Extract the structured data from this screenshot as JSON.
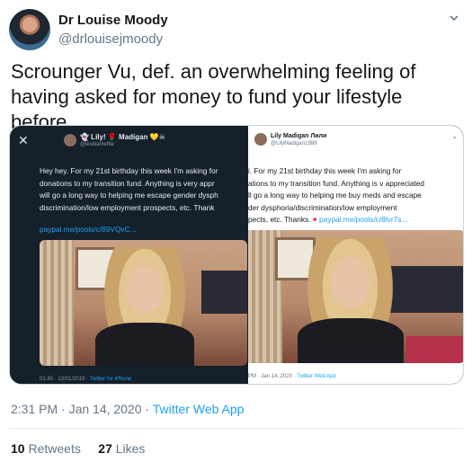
{
  "author": {
    "name": "Dr Louise Moody",
    "handle": "@drlouisejmoody"
  },
  "tweet": {
    "text": "Scrounger Vu,  def. an overwhelming feeling of having asked for money to fund your lifestyle before."
  },
  "embedded_left": {
    "name": "👻 Lily! 🌹 Madigan 💛☠",
    "handle": "@lesbianleftie",
    "text": "Hey hey. For my 21st birthday this week I'm asking for\ndonations to my transition fund. Anything is very appr\nwill go a long way to helping me escape gender dysph\ndiscrimination/low employment prospects, etc. Thank",
    "link": "paypal.me/pools/c/89VQvC...",
    "time": "01:45 · 13/01/2019 ·",
    "app": "Twitter for iPhone"
  },
  "embedded_right": {
    "name": "Lily Madigan Лили",
    "handle": "@LilyMadigan1999",
    "text": "i. For my 21st birthday this week I'm asking for\nations to my transition fund. Anything is v appreciated\nll go a long way to helping me buy meds and escape\nder dysphoria/discrimination/low employment\npects, etc. Thanks.",
    "link": "paypal.me/pools/c/8lvr7s...",
    "time": "PM · Jan 14, 2020 ·",
    "app": "Twitter Web App"
  },
  "meta": {
    "time": "2:31 PM · Jan 14, 2020 ·",
    "app": "Twitter Web App"
  },
  "stats": {
    "retweets_count": "10",
    "retweets_label": "Retweets",
    "likes_count": "27",
    "likes_label": "Likes"
  },
  "colors": {
    "link": "#1da1f2",
    "muted": "#657786",
    "dark_bg": "#15202b"
  },
  "icons": [
    "chevron-down-icon",
    "close-icon",
    "heart-icon"
  ]
}
